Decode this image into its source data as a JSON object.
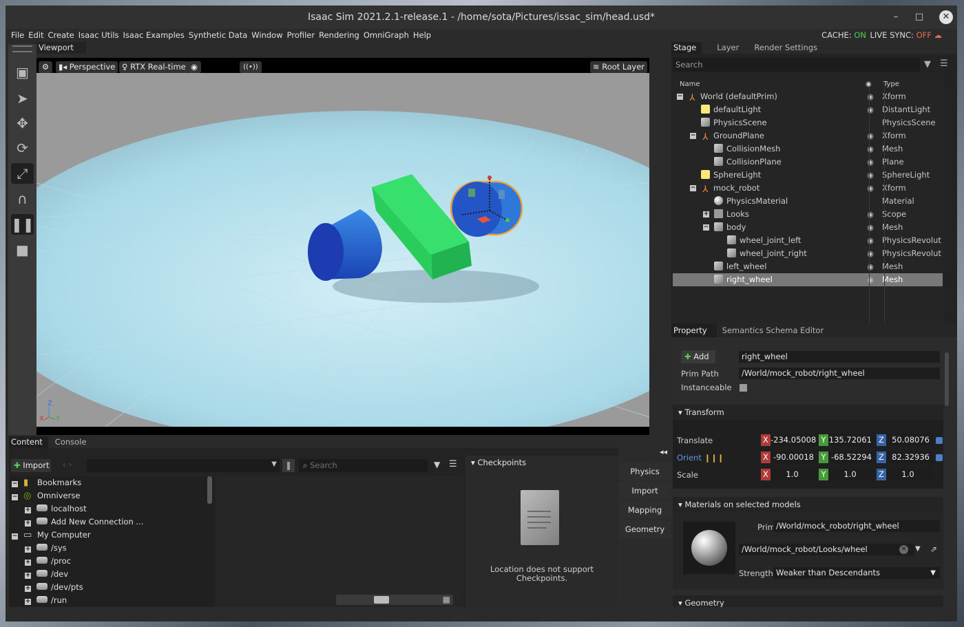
{
  "window": {
    "title": "Isaac Sim 2021.2.1-release.1 - /home/sota/Pictures/issac_sim/head.usd*",
    "minimize_glyph": "–",
    "maximize_glyph": "□",
    "close_glyph": "✕"
  },
  "menu": [
    "File",
    "Edit",
    "Create",
    "Isaac Utils",
    "Isaac Examples",
    "Synthetic Data",
    "Window",
    "Profiler",
    "Rendering",
    "OmniGraph",
    "Help"
  ],
  "status": {
    "cache_label": "CACHE:",
    "cache_value": "ON",
    "livesync_label": "LIVE SYNC:",
    "livesync_value": "OFF"
  },
  "viewport": {
    "tab": "Viewport",
    "camera": "Perspective",
    "renderer": "RTX Real-time",
    "layer": "Root Layer",
    "axis_z": "Z",
    "axis_x": "X",
    "axis_y": "Y",
    "broadcast_glyph": "((•))"
  },
  "stage": {
    "tabs": [
      "Stage",
      "Layer",
      "Render Settings"
    ],
    "search_placeholder": "Search",
    "col_name": "Name",
    "col_type": "Type",
    "rows": [
      {
        "name": "World (defaultPrim)",
        "type": "Xform"
      },
      {
        "name": "defaultLight",
        "type": "DistantLight"
      },
      {
        "name": "PhysicsScene",
        "type": "PhysicsScene"
      },
      {
        "name": "GroundPlane",
        "type": "Xform"
      },
      {
        "name": "CollisionMesh",
        "type": "Mesh"
      },
      {
        "name": "CollisionPlane",
        "type": "Plane"
      },
      {
        "name": "SphereLight",
        "type": "SphereLight"
      },
      {
        "name": "mock_robot",
        "type": "Xform"
      },
      {
        "name": "PhysicsMaterial",
        "type": "Material"
      },
      {
        "name": "Looks",
        "type": "Scope"
      },
      {
        "name": "body",
        "type": "Mesh"
      },
      {
        "name": "wheel_joint_left",
        "type": "PhysicsRevolute.."
      },
      {
        "name": "wheel_joint_right",
        "type": "PhysicsRevolute.."
      },
      {
        "name": "left_wheel",
        "type": "Mesh"
      },
      {
        "name": "right_wheel",
        "type": "Mesh"
      }
    ]
  },
  "property": {
    "tabs": [
      "Property",
      "Semantics Schema Editor"
    ],
    "add_label": "Add",
    "name_value": "right_wheel",
    "prim_path_label": "Prim Path",
    "prim_path_value": "/World/mock_robot/right_wheel",
    "instanceable_label": "Instanceable",
    "transform": {
      "header": "Transform",
      "translate_label": "Translate",
      "orient_label": "Orient",
      "scale_label": "Scale",
      "translate": [
        "-234.05008",
        "135.72061",
        "50.08076"
      ],
      "orient": [
        "-90.00018",
        "-68.52294",
        "82.32936"
      ],
      "scale": [
        "1.0",
        "1.0",
        "1.0"
      ]
    },
    "materials": {
      "header": "Materials on selected models",
      "prim_label": "Prim",
      "prim_value": "/World/mock_robot/right_wheel",
      "material_value": "/World/mock_robot/Looks/wheel",
      "strength_label": "Strength",
      "strength_value": "Weaker than Descendants"
    },
    "geometry_header": "Geometry"
  },
  "content": {
    "tabs": [
      "Content",
      "Console"
    ],
    "import_label": "Import",
    "search_placeholder": "Search",
    "tree": [
      {
        "label": "Bookmarks",
        "level": 0
      },
      {
        "label": "Omniverse",
        "level": 0
      },
      {
        "label": "localhost",
        "level": 1
      },
      {
        "label": "Add New Connection ...",
        "level": 1
      },
      {
        "label": "My Computer",
        "level": 0
      },
      {
        "label": "/sys",
        "level": 1
      },
      {
        "label": "/proc",
        "level": 1
      },
      {
        "label": "/dev",
        "level": 1
      },
      {
        "label": "/dev/pts",
        "level": 1
      },
      {
        "label": "/run",
        "level": 1
      }
    ],
    "checkpoints_header": "Checkpoints",
    "checkpoints_msg_1": "Location does not support",
    "checkpoints_msg_2": "Checkpoints."
  },
  "sidebar": {
    "collapse_glyph": "◂◂",
    "buttons": [
      "Physics",
      "Import",
      "Mapping",
      "Geometry"
    ]
  }
}
